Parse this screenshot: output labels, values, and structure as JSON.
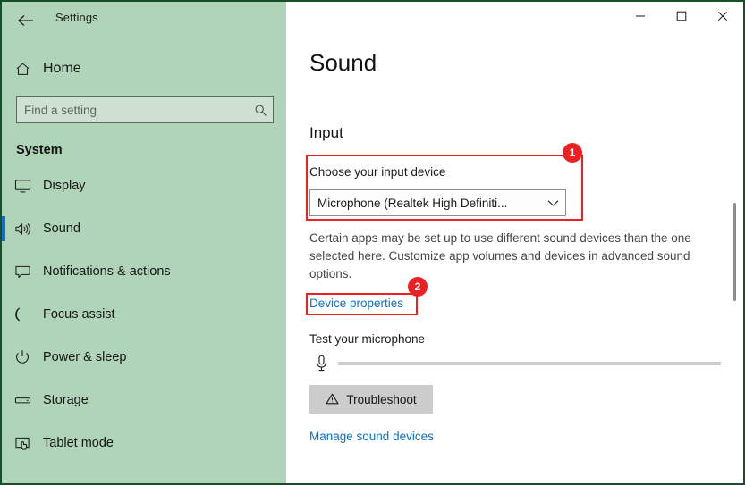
{
  "window": {
    "title": "Settings",
    "border_color": "#14512a",
    "controls": {
      "minimize": "—",
      "maximize": "☐",
      "close": "✕"
    },
    "back_arrow": "←"
  },
  "sidebar": {
    "background_color": "#b0d4b8",
    "home_label": "Home",
    "home_icon": "home-icon",
    "search": {
      "placeholder": "Find a setting",
      "value": "",
      "icon": "search-icon"
    },
    "group_header": "System",
    "accent_color": "#0c6fd1",
    "items": [
      {
        "label": "Display",
        "icon": "monitor-icon",
        "selected": false
      },
      {
        "label": "Sound",
        "icon": "speaker-icon",
        "selected": true
      },
      {
        "label": "Notifications & actions",
        "icon": "chat-bubble-icon",
        "selected": false
      },
      {
        "label": "Focus assist",
        "icon": "moon-icon",
        "selected": false
      },
      {
        "label": "Power & sleep",
        "icon": "power-icon",
        "selected": false
      },
      {
        "label": "Storage",
        "icon": "drive-icon",
        "selected": false
      },
      {
        "label": "Tablet mode",
        "icon": "tablet-hand-icon",
        "selected": false
      }
    ]
  },
  "main": {
    "page_title": "Sound",
    "input_section": {
      "heading": "Input",
      "choose_label": "Choose your input device",
      "selected_device": "Microphone (Realtek High Definiti...",
      "chevron": "⌄",
      "description": "Certain apps may be set up to use different sound devices than the one selected here. Customize app volumes and devices in advanced sound options.",
      "device_properties_link": "Device properties",
      "test_mic_label": "Test your microphone",
      "mic_icon": "microphone-icon",
      "mic_level_percent": 0,
      "troubleshoot_label": "Troubleshoot",
      "troubleshoot_icon": "warning-triangle-icon",
      "manage_devices_link": "Manage sound devices"
    }
  },
  "annotations": {
    "accent_color": "#ed2024",
    "badges": [
      {
        "number": "1",
        "target": "choose-your-input-device-group"
      },
      {
        "number": "2",
        "target": "device-properties-link"
      }
    ]
  }
}
